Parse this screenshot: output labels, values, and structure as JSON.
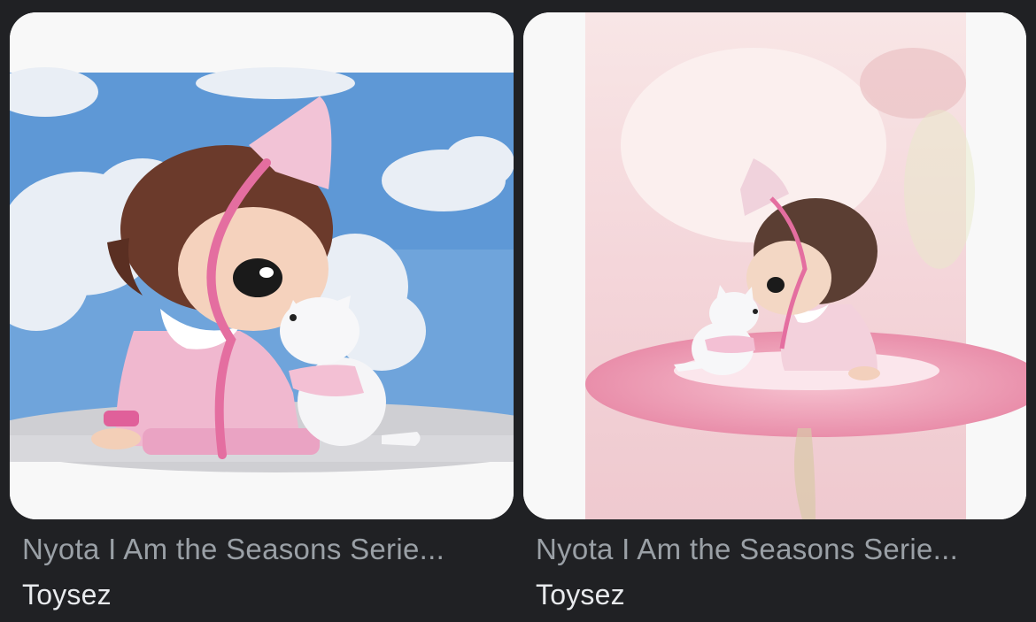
{
  "results": [
    {
      "title": "Nyota I Am the Seasons Serie...",
      "source": "Toysez",
      "image_alt": "Nyota figure with pink hat kissing white cat, blue sky with clouds background"
    },
    {
      "title": "Nyota I Am the Seasons Serie...",
      "source": "Toysez",
      "image_alt": "Nyota figure with pink hat and white cat sitting on pink flower, soft pink background"
    }
  ],
  "colors": {
    "page_background": "#202124",
    "title_text": "#9aa0a6",
    "source_text": "#e8eaed"
  }
}
